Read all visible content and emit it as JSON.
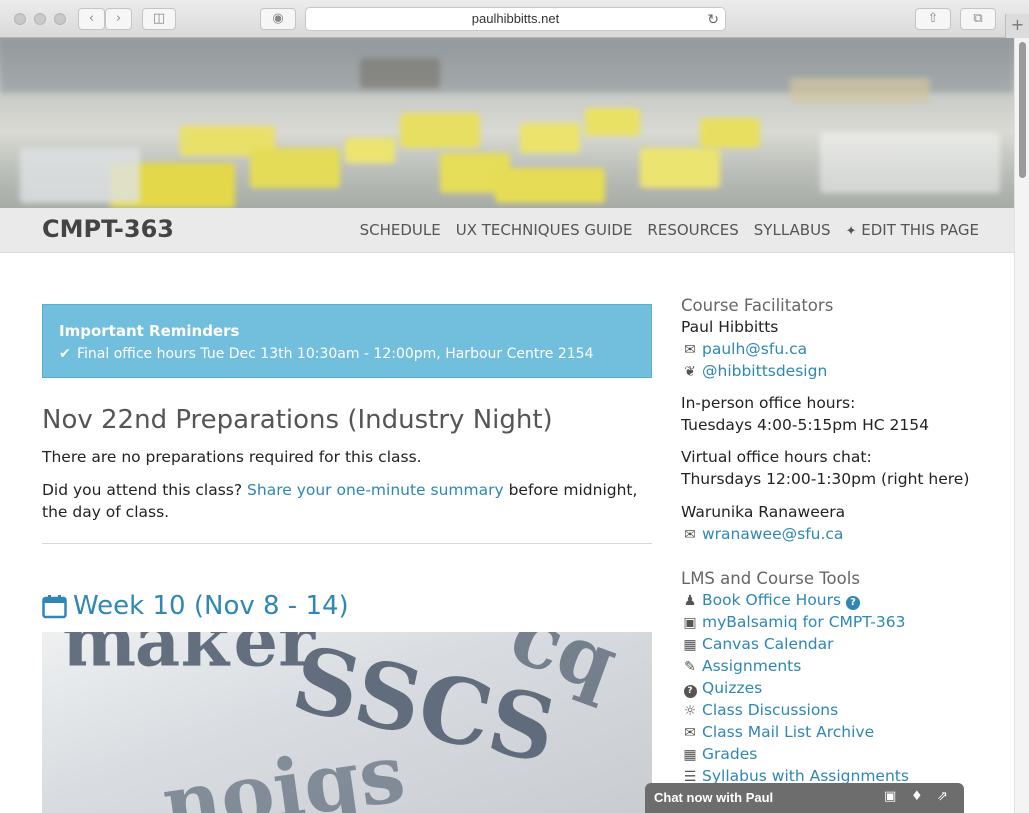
{
  "browser": {
    "url": "paulhibbitts.net"
  },
  "navbar": {
    "brand": "CMPT-363",
    "links": [
      "SCHEDULE",
      "UX TECHNIQUES GUIDE",
      "RESOURCES",
      "SYLLABUS",
      "EDIT THIS PAGE"
    ]
  },
  "reminders": {
    "title": "Important Reminders",
    "item": "Final office hours Tue Dec 13th 10:30am - 12:00pm, Harbour Centre 2154"
  },
  "prep": {
    "heading": "Nov 22nd Preparations (Industry Night)",
    "line1": "There are no preparations required for this class.",
    "line2_pre": "Did you attend this class? ",
    "line2_link": "Share your one-minute summary",
    "line2_post": " before midnight, the day of class."
  },
  "week": {
    "heading": "Week 10 (Nov 8 - 14)"
  },
  "sidebar": {
    "facilitators_title": "Course Facilitators",
    "name1": "Paul Hibbitts",
    "email1": "paulh@sfu.ca",
    "twitter": "@hibbittsdesign",
    "inperson_label": "In-person office hours:",
    "inperson_value": "Tuesdays 4:00-5:15pm HC 2154",
    "virtual_label": "Virtual office hours chat:",
    "virtual_value": "Thursdays 12:00-1:30pm (right here)",
    "name2": "Warunika Ranaweera",
    "email2": "wranawee@sfu.ca",
    "tools_title": "LMS and Course Tools",
    "tools": [
      "Book Office Hours",
      "myBalsamiq for CMPT-363",
      "Canvas Calendar",
      "Assignments",
      "Quizzes",
      "Class Discussions",
      "Class Mail List Archive",
      "Grades",
      "Syllabus with Assignments"
    ]
  },
  "chat": {
    "label": "Chat now with Paul"
  }
}
